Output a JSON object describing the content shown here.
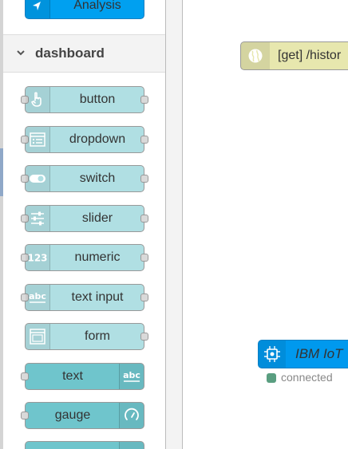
{
  "palette": {
    "analysis_node": {
      "label": "Analysis",
      "color": "#00a0f0"
    },
    "category": {
      "title": "dashboard",
      "icon": "chevron-down-icon"
    },
    "colors": {
      "light_node": "#b0dfe3",
      "dark_node": "#6fc5cc"
    },
    "nodes": [
      {
        "label": "button",
        "icon": "hand-pointer-icon"
      },
      {
        "label": "dropdown",
        "icon": "list-icon"
      },
      {
        "label": "switch",
        "icon": "toggle-icon"
      },
      {
        "label": "slider",
        "icon": "sliders-icon"
      },
      {
        "label": "numeric",
        "icon": "numeric-123-icon"
      },
      {
        "label": "text input",
        "icon": "abc-text-icon"
      },
      {
        "label": "form",
        "icon": "form-icon"
      },
      {
        "label": "text",
        "icon": "abc-text-icon"
      },
      {
        "label": "gauge",
        "icon": "gauge-icon"
      }
    ]
  },
  "workspace": {
    "http_node": {
      "label": "[get] /histor",
      "color": "#e7e7ae",
      "icon": "globe-icon"
    },
    "ibm_node": {
      "label": "IBM IoT",
      "color": "#0099ee",
      "icon": "chip-icon"
    },
    "ibm_status": {
      "text": "connected",
      "color": "#5a9e80"
    }
  }
}
